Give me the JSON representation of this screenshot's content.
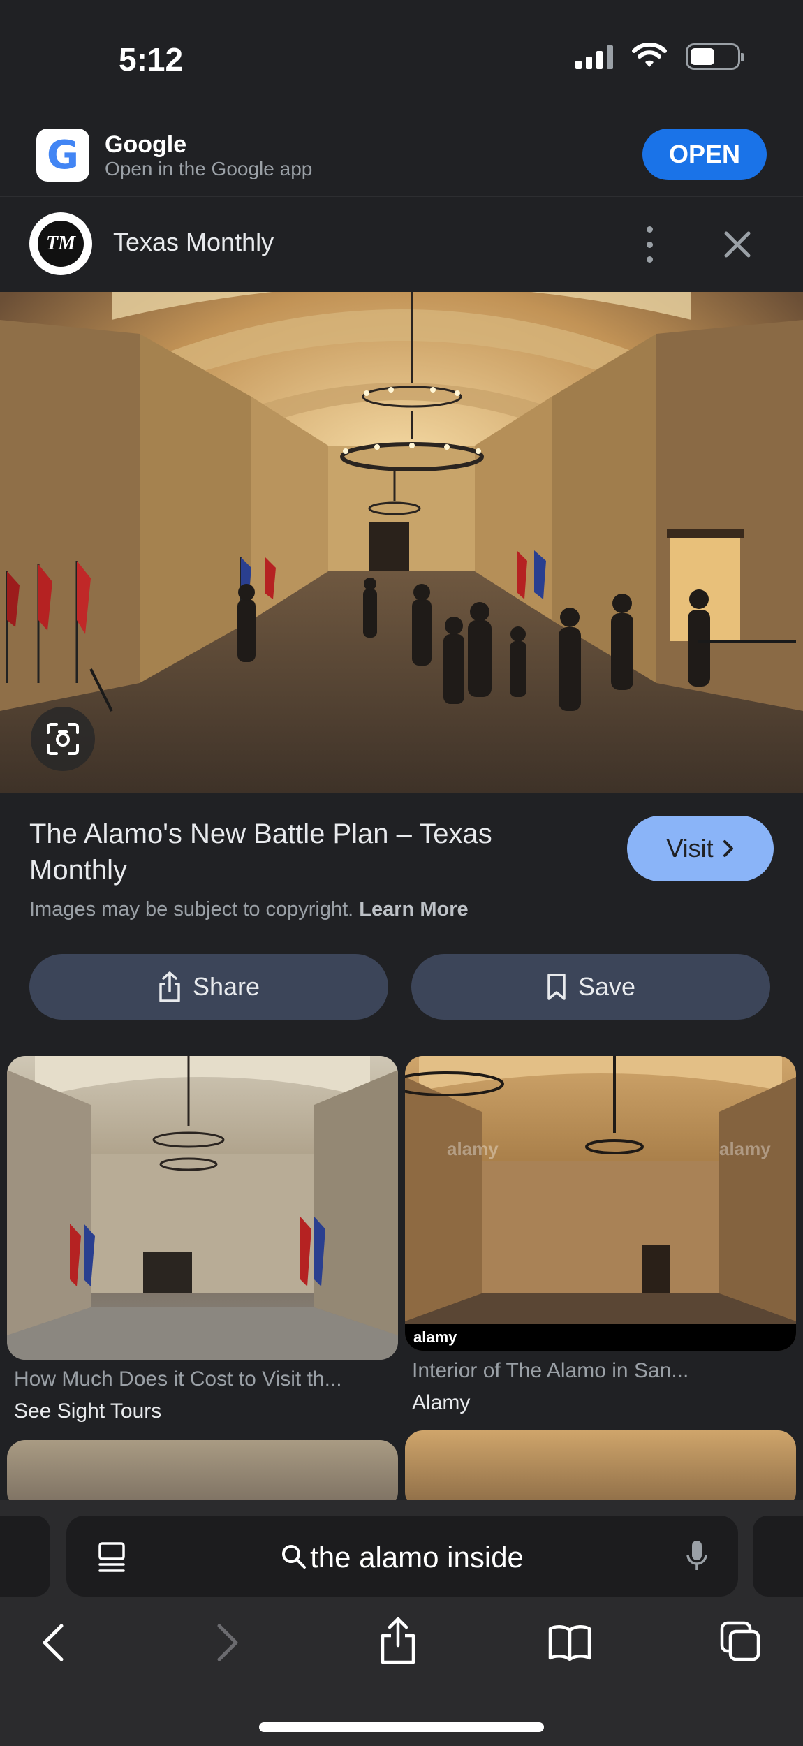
{
  "status_bar": {
    "time": "5:12"
  },
  "app_banner": {
    "app_name": "Google",
    "subtitle": "Open in the Google app",
    "open_label": "OPEN",
    "logo_letter": "G"
  },
  "source": {
    "logo_text": "TM",
    "name": "Texas Monthly"
  },
  "result": {
    "title": "The Alamo's New Battle Plan – Texas Monthly",
    "visit_label": "Visit",
    "copyright_text": "Images may be subject to copyright.",
    "learn_more": "Learn More",
    "share_label": "Share",
    "save_label": "Save"
  },
  "related": [
    {
      "title": "How Much Does it Cost to Visit th...",
      "source": "See Sight Tours"
    },
    {
      "title": "Interior of The Alamo in San...",
      "source": "Alamy",
      "watermark": "alamy"
    }
  ],
  "browser": {
    "address_text": "the alamo inside"
  },
  "colors": {
    "background": "#202124",
    "open_button": "#1a73e8",
    "visit_button": "#8ab4f8",
    "action_button": "#3c4559"
  }
}
